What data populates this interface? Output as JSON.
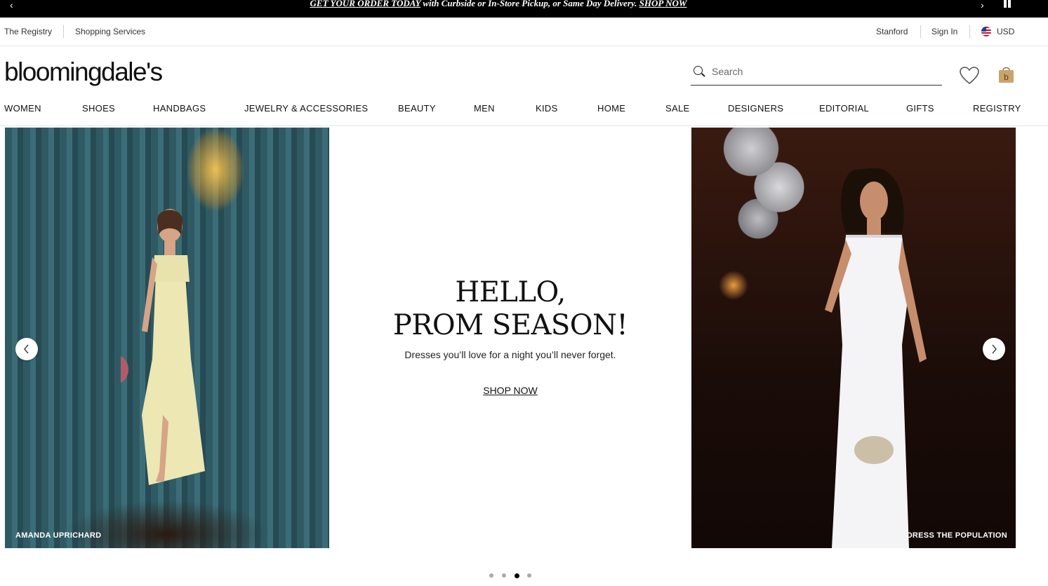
{
  "promo": {
    "link_text": "GET YOUR ORDER TODAY",
    "message": " with Curbside or In-Store Pickup, or Same Day Delivery. ",
    "cta": "SHOP NOW"
  },
  "utility": {
    "left_links": [
      "The Registry",
      "Shopping Services"
    ],
    "store": "Stanford",
    "sign_in": "Sign In",
    "currency": "USD"
  },
  "brand": {
    "logo_text": "bloomingdale's"
  },
  "search": {
    "placeholder": "Search"
  },
  "nav": {
    "items": [
      "WOMEN",
      "SHOES",
      "HANDBAGS",
      "JEWELRY & ACCESSORIES",
      "BEAUTY",
      "MEN",
      "KIDS",
      "HOME",
      "SALE",
      "DESIGNERS",
      "EDITORIAL",
      "GIFTS",
      "REGISTRY"
    ]
  },
  "hero": {
    "headline_line1": "HELLO,",
    "headline_line2": "PROM SEASON!",
    "subline": "Dresses you’ll love for a night you’ll never forget.",
    "cta": "SHOP NOW",
    "left_credit": "AMANDA UPRICHARD",
    "right_credit": "DRESS THE POPULATION",
    "slide_count": 4,
    "active_slide": 3
  },
  "colors": {
    "promo_bg": "#000000",
    "bag_gold": "#c9a46a",
    "text": "#111111"
  },
  "icons": [
    "chevron-left-icon",
    "chevron-right-icon",
    "pause-icon",
    "flag-us-icon",
    "search-icon",
    "heart-icon",
    "shopping-bag-icon"
  ]
}
